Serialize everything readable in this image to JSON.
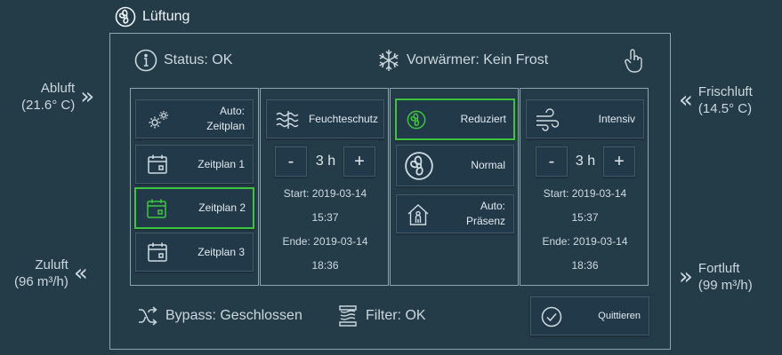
{
  "window": {
    "title": "Lüftung"
  },
  "sides": {
    "abluft": {
      "name": "Abluft",
      "value": "(21.6° C)"
    },
    "frischluft": {
      "name": "Frischluft",
      "value": "(14.5° C)"
    },
    "zuluft": {
      "name": "Zuluft",
      "value": "(96 m³/h)"
    },
    "fortluft": {
      "name": "Fortluft",
      "value": "(99 m³/h)"
    }
  },
  "status": {
    "label": "Status: OK"
  },
  "vorwaermer": {
    "label": "Vorwärmer: Kein Frost"
  },
  "modes": {
    "auto_zeitplan": {
      "line1": "Auto:",
      "line2": "Zeitplan"
    },
    "zeitplan1": "Zeitplan 1",
    "zeitplan2": "Zeitplan 2",
    "zeitplan3": "Zeitplan 3",
    "active": "Zeitplan 2"
  },
  "feuchteschutz": {
    "label": "Feuchteschutz",
    "minus": "-",
    "duration": "3 h",
    "plus": "+",
    "start_label": "Start: 2019-03-14",
    "start_time": "15:37",
    "end_label": "Ende: 2019-03-14",
    "end_time": "18:36"
  },
  "levels": {
    "reduziert": "Reduziert",
    "normal": "Normal",
    "auto_praesenz": {
      "line1": "Auto:",
      "line2": "Präsenz"
    },
    "active": "Reduziert"
  },
  "intensiv": {
    "label": "Intensiv",
    "minus": "-",
    "duration": "3 h",
    "plus": "+",
    "start_label": "Start: 2019-03-14",
    "start_time": "15:37",
    "end_label": "Ende: 2019-03-14",
    "end_time": "18:36"
  },
  "bypass": {
    "label": "Bypass: Geschlossen"
  },
  "filter": {
    "label": "Filter: OK"
  },
  "quittieren": {
    "label": "Quittieren"
  },
  "colors": {
    "background": "#243b48",
    "active": "#3ec53e",
    "border": "#8fa5ae",
    "text": "#dce6ea"
  }
}
